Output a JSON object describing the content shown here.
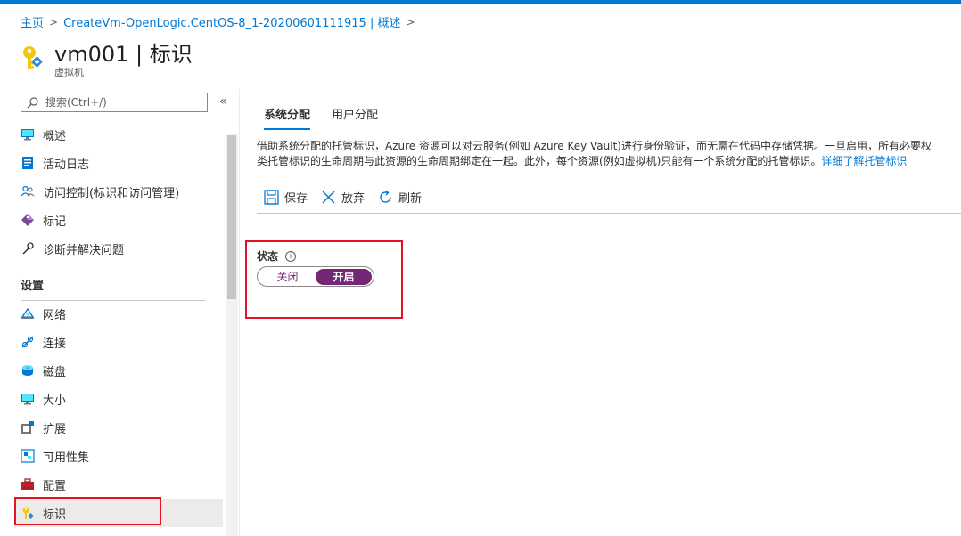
{
  "breadcrumb": {
    "home": "主页",
    "deployment": "CreateVm-OpenLogic.CentOS-8_1-20200601111915 | 概述"
  },
  "header": {
    "title": "vm001 | 标识",
    "subtitle": "虚拟机"
  },
  "sidebar": {
    "search_placeholder": "搜索(Ctrl+/)",
    "collapse": "«",
    "items_top": [
      {
        "label": "概述",
        "icon": "monitor-icon"
      },
      {
        "label": "活动日志",
        "icon": "activity-log-icon"
      },
      {
        "label": "访问控制(标识和访问管理)",
        "icon": "people-icon"
      },
      {
        "label": "标记",
        "icon": "tag-icon"
      },
      {
        "label": "诊断并解决问题",
        "icon": "wrench-icon"
      }
    ],
    "section_settings": "设置",
    "items_settings": [
      {
        "label": "网络",
        "icon": "network-icon"
      },
      {
        "label": "连接",
        "icon": "connect-icon"
      },
      {
        "label": "磁盘",
        "icon": "disk-icon"
      },
      {
        "label": "大小",
        "icon": "size-monitor-icon"
      },
      {
        "label": "扩展",
        "icon": "extension-icon"
      },
      {
        "label": "可用性集",
        "icon": "availability-set-icon"
      },
      {
        "label": "配置",
        "icon": "configuration-icon"
      },
      {
        "label": "标识",
        "icon": "identity-key-icon"
      }
    ]
  },
  "tabs": [
    {
      "label": "系统分配",
      "active": true
    },
    {
      "label": "用户分配",
      "active": false
    }
  ],
  "description": {
    "line1": "借助系统分配的托管标识，Azure 资源可以对云服务(例如 Azure Key Vault)进行身份验证，而无需在代码中存储凭据。一旦启用，所有必要权",
    "line2": "类托管标识的生命周期与此资源的生命周期绑定在一起。此外，每个资源(例如虚拟机)只能有一个系统分配的托管标识。",
    "link": "详细了解托管标识"
  },
  "toolbar": {
    "save": "保存",
    "discard": "放弃",
    "refresh": "刷新"
  },
  "status": {
    "label": "状态",
    "info": "i",
    "off": "关闭",
    "on": "开启",
    "value": "on"
  },
  "colors": {
    "accent": "#0078d4",
    "toggle": "#742774",
    "highlight": "#e81123"
  }
}
